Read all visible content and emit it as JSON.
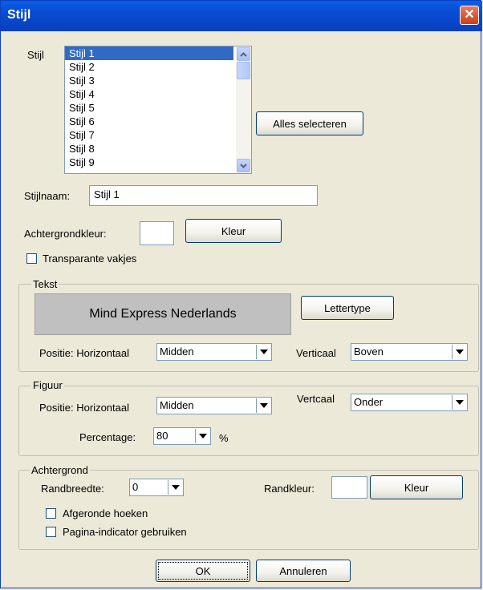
{
  "window": {
    "title": "Stijl",
    "close_glyph": "✕"
  },
  "style_list": {
    "label": "Stijl",
    "items": [
      "Stijl 1",
      "Stijl 2",
      "Stijl 3",
      "Stijl 4",
      "Stijl 5",
      "Stijl 6",
      "Stijl 7",
      "Stijl 8",
      "Stijl 9"
    ],
    "selected_index": 0,
    "select_all_button": "Alles selecteren"
  },
  "style_name": {
    "label": "Stijlnaam:",
    "value": "Stijl 1"
  },
  "background": {
    "label": "Achtergrondkleur:",
    "color": "#ffffff",
    "color_button": "Kleur"
  },
  "transparent_cells": {
    "label": "Transparante vakjes",
    "checked": false
  },
  "text_group": {
    "label": "Tekst",
    "preview_text": "Mind Express Nederlands",
    "font_button": "Lettertype",
    "horizontal_label": "Positie: Horizontaal",
    "horizontal_value": "Midden",
    "vertical_label": "Verticaal",
    "vertical_value": "Boven"
  },
  "figure_group": {
    "label": "Figuur",
    "horizontal_label": "Positie: Horizontaal",
    "horizontal_value": "Midden",
    "vertical_label": "Vertcaal",
    "vertical_value": "Onder",
    "percentage_label": "Percentage:",
    "percentage_value": "80",
    "percentage_unit": "%"
  },
  "background_group": {
    "label": "Achtergrond",
    "border_width_label": "Randbreedte:",
    "border_width_value": "0",
    "border_color_label": "Randkleur:",
    "border_color": "#ffffff",
    "border_color_button": "Kleur",
    "rounded_corners": {
      "label": "Afgeronde hoeken",
      "checked": false
    },
    "page_indicator": {
      "label": "Pagina-indicator gebruiken",
      "checked": false
    }
  },
  "buttons": {
    "ok": "OK",
    "cancel": "Annuleren"
  }
}
